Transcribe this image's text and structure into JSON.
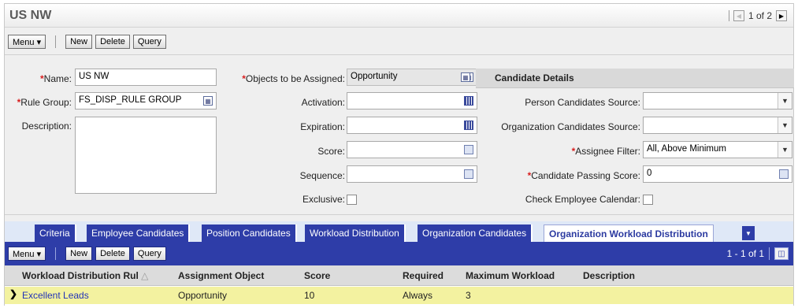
{
  "title": "US NW",
  "record_pager": "1 of 2",
  "toolbar": {
    "menu": "Menu ▾",
    "new": "New",
    "delete": "Delete",
    "query": "Query"
  },
  "form": {
    "name_label": "Name:",
    "name_value": "US NW",
    "rule_group_label": "Rule Group:",
    "rule_group_value": "FS_DISP_RULE GROUP",
    "description_label": "Description:",
    "description_value": "",
    "objects_label": "Objects to be Assigned:",
    "objects_value": "Opportunity",
    "activation_label": "Activation:",
    "activation_value": "",
    "expiration_label": "Expiration:",
    "expiration_value": "",
    "score_label": "Score:",
    "score_value": "",
    "sequence_label": "Sequence:",
    "sequence_value": "",
    "exclusive_label": "Exclusive:",
    "exclusive_checked": false
  },
  "candidate_details": {
    "header": "Candidate Details",
    "person_source_label": "Person Candidates Source:",
    "person_source_value": "",
    "org_source_label": "Organization Candidates Source:",
    "org_source_value": "",
    "assignee_filter_label": "Assignee Filter:",
    "assignee_filter_value": "All, Above Minimum",
    "passing_score_label": "Candidate Passing Score:",
    "passing_score_value": "0",
    "check_calendar_label": "Check Employee Calendar:",
    "check_calendar_checked": false
  },
  "tabs": [
    {
      "label": "Criteria"
    },
    {
      "label": "Employee Candidates"
    },
    {
      "label": "Position Candidates"
    },
    {
      "label": "Workload Distribution"
    },
    {
      "label": "Organization Candidates"
    },
    {
      "label": "Organization Workload Distribution",
      "active": true
    }
  ],
  "list": {
    "toolbar": {
      "menu": "Menu ▾",
      "new": "New",
      "delete": "Delete",
      "query": "Query"
    },
    "pager": "1 - 1 of 1",
    "columns": [
      "Workload Distribution Rul",
      "Assignment Object",
      "Score",
      "Required",
      "Maximum Workload",
      "Description"
    ],
    "sort_indicator": "△",
    "rows": [
      {
        "rule": "Excellent Leads",
        "object": "Opportunity",
        "score": "10",
        "required": "Always",
        "max_workload": "3",
        "description": ""
      }
    ]
  },
  "colors": {
    "accent": "#2e3da8",
    "required": "#d81e1e",
    "row_highlight": "#f3f2a0"
  }
}
